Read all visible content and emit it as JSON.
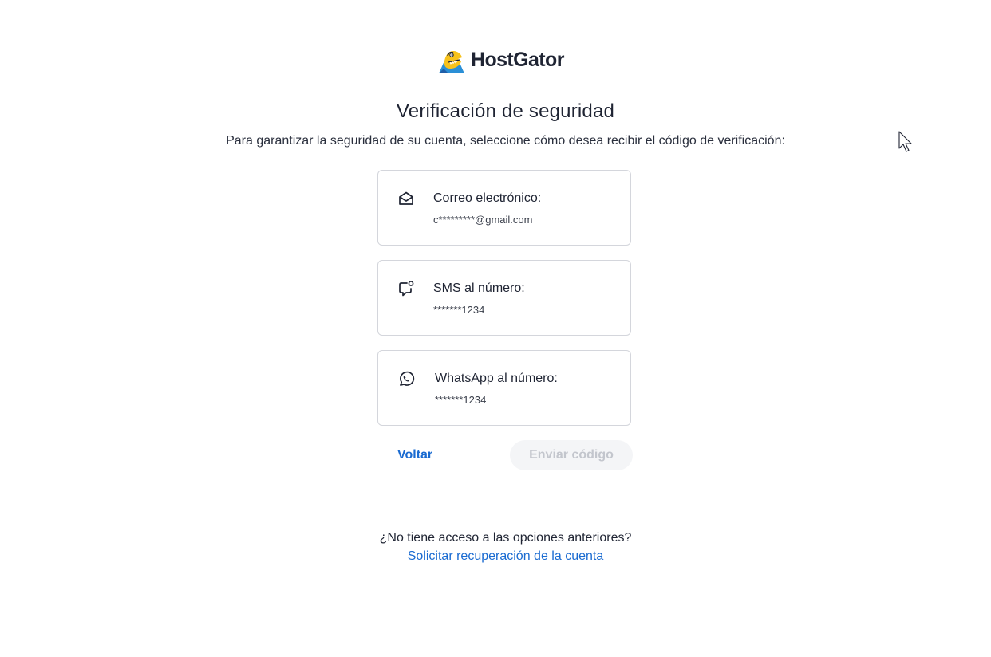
{
  "brand": {
    "name": "HostGator"
  },
  "header": {
    "title": "Verificación de seguridad",
    "subtitle": "Para garantizar la seguridad de su cuenta, seleccione cómo desea recibir el código de verificación:"
  },
  "options": [
    {
      "icon": "envelope-icon",
      "label": "Correo electrónico:",
      "value": "c*********@gmail.com"
    },
    {
      "icon": "sms-chat-icon",
      "label": "SMS al número:",
      "value": "*******1234"
    },
    {
      "icon": "whatsapp-icon",
      "label": "WhatsApp al número:",
      "value": "*******1234"
    }
  ],
  "actions": {
    "back_label": "Voltar",
    "send_label": "Enviar código"
  },
  "footer": {
    "question": "¿No tiene acceso a las opciones anteriores?",
    "recover_link": "Solicitar recuperación de la cuenta"
  },
  "colors": {
    "link": "#1a6bd1",
    "text": "#1f2433",
    "border": "#d4d6dc",
    "disabled_bg": "#f4f5f7",
    "disabled_text": "#c3c6cd",
    "logo_blue": "#2a8fd6",
    "logo_yellow": "#f7c21b"
  }
}
